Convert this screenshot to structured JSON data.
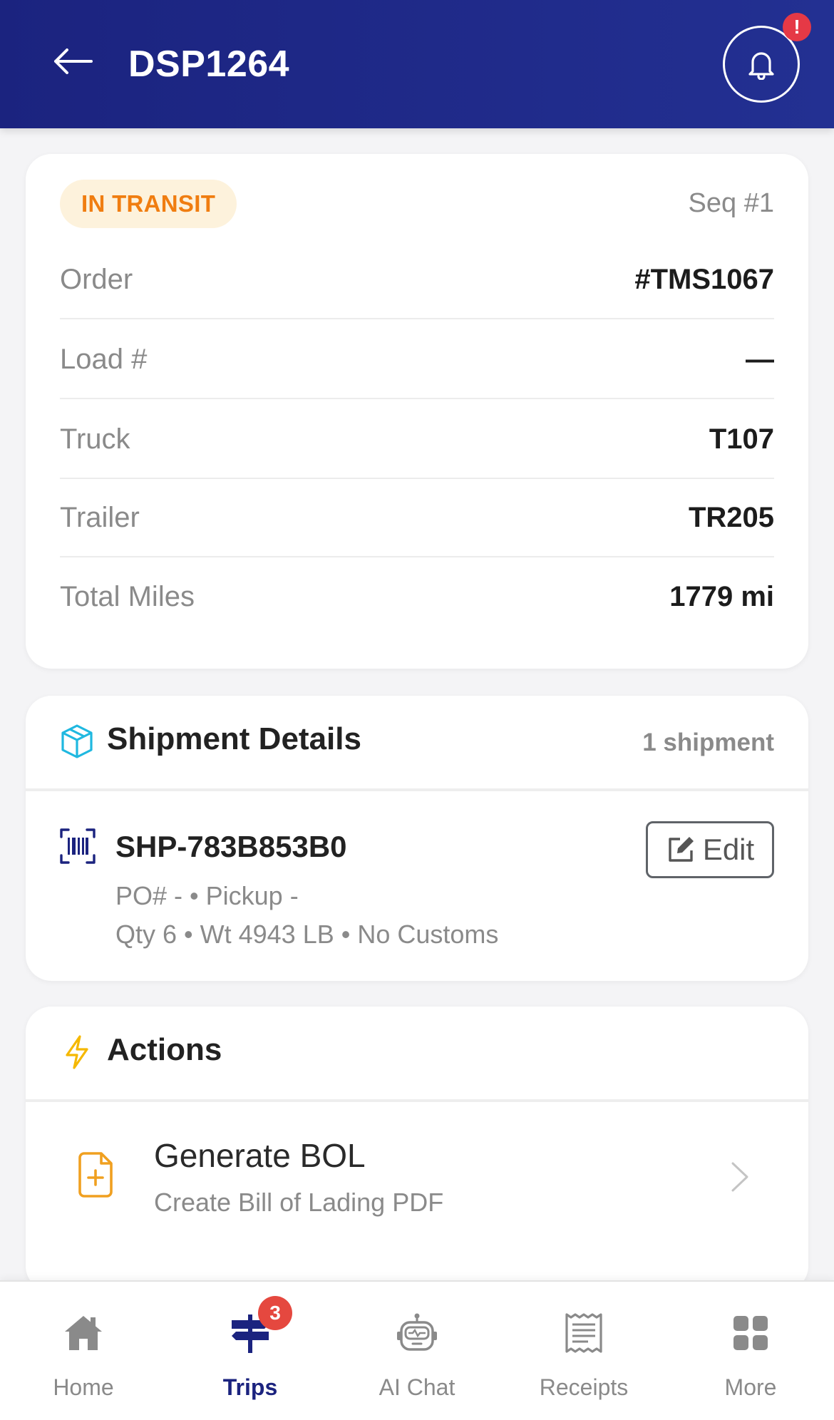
{
  "header": {
    "title": "DSP1264",
    "notification_badge": "!",
    "back_icon": "arrow-left-icon",
    "bell_icon": "bell-icon"
  },
  "status_card": {
    "status": "IN TRANSIT",
    "sequence": "Seq #1",
    "rows": [
      {
        "label": "Order",
        "value": "#TMS1067"
      },
      {
        "label": "Load #",
        "value": "—"
      },
      {
        "label": "Truck",
        "value": "T107"
      },
      {
        "label": "Trailer",
        "value": "TR205"
      },
      {
        "label": "Total Miles",
        "value": "1779 mi"
      }
    ]
  },
  "shipment": {
    "title": "Shipment Details",
    "count": "1 shipment",
    "id": "SHP-783B853B0",
    "edit_label": "Edit",
    "meta_line_1": "PO# - • Pickup -",
    "meta_line_2": "Qty 6 • Wt 4943 LB • No Customs"
  },
  "actions": {
    "title": "Actions",
    "items": [
      {
        "title": "Generate BOL",
        "subtitle": "Create Bill of Lading PDF",
        "icon": "file-plus-icon"
      }
    ]
  },
  "nav": {
    "items": [
      {
        "label": "Home",
        "icon": "home-icon"
      },
      {
        "label": "Trips",
        "icon": "signpost-icon",
        "badge": "3"
      },
      {
        "label": "AI Chat",
        "icon": "robot-icon"
      },
      {
        "label": "Receipts",
        "icon": "receipt-icon"
      },
      {
        "label": "More",
        "icon": "grid-icon"
      }
    ],
    "active": "Trips"
  },
  "colors": {
    "header": "#1b237f",
    "status_text": "#f07d10",
    "status_bg": "#fdf2dc",
    "accent_cyan": "#1fb8e0",
    "accent_yellow": "#f5b800",
    "accent_orange": "#f0a020",
    "badge_red": "#e53946"
  }
}
